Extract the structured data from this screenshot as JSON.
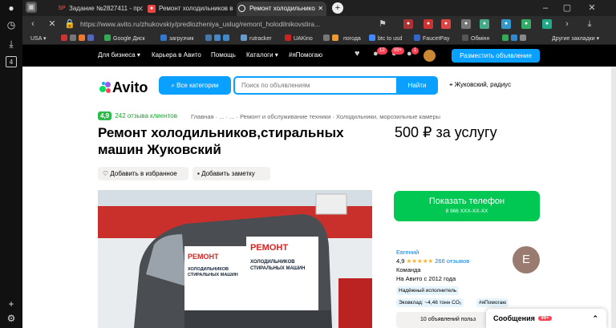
{
  "browser": {
    "tabs": [
      {
        "label": "Задание №2827411 - про",
        "favicon": "SP"
      },
      {
        "label": "Ремонт холодильников в",
        "favicon": "avito"
      },
      {
        "label": "Ремонт холодильнико",
        "favicon": "loading"
      }
    ],
    "url": "https://www.avito.ru/zhukovskiy/predlozheniya_uslug/remont_holodilnikovstira...",
    "bookmarks": [
      "USA",
      "Google Диск",
      "загрузчик",
      "rutracker",
      "UAKino",
      "погода",
      "btc to usd",
      "FaucetPay",
      "Обмінн",
      "Другие закладки"
    ]
  },
  "topnav": {
    "items": [
      "Для бизнеса",
      "Карьера в Авито",
      "Помощь",
      "Каталоги",
      "#яПомогаю"
    ],
    "badges": [
      "12",
      "99+",
      "1"
    ],
    "post_button": "Разместить объявление"
  },
  "header": {
    "logo": "Avito",
    "categories_button": "Все категории",
    "search_placeholder": "Поиск по объявлениям",
    "find_button": "Найти",
    "location": "Жуковский, радиус"
  },
  "listing": {
    "rating": "4,9",
    "reviews_link": "242 отзыва клиентов",
    "breadcrumbs": [
      "Главная",
      "...",
      "...",
      "Ремонт и обслуживание техники",
      "Холодильники, морозильные камеры"
    ],
    "title": "Ремонт холодильников,стиральных машин Жуковский",
    "price": "500 ₽ за услугу",
    "favorite_label": "Добавить в избранное",
    "note_label": "Добавить заметку",
    "van_text": [
      "РЕМОНТ",
      "ХОЛОДИЛЬНИКОВ",
      "СТИРАЛЬНЫХ МАШИН"
    ]
  },
  "contact": {
    "call_button": "Показать телефон",
    "phone_mask": "8 966 XXX-XX-XX",
    "seller_name": "Евгений",
    "seller_rating": "4,9",
    "seller_reviews": "266 отзывов",
    "seller_type": "Команда",
    "since": "На Авито с 2012 года",
    "avatar_letter": "Е",
    "tags": [
      "Надёжный исполнитель",
      "Эковклад: ~4,46 тонн CO₂",
      "#яПомогаю"
    ],
    "more_listings": "10 объявлений польз"
  },
  "messages": {
    "label": "Сообщения",
    "count": "99+"
  },
  "colors": {
    "avito_blue": "#0aa0ff",
    "call_green": "#00c853",
    "nav_black": "#000000",
    "star": "#ffb021"
  }
}
